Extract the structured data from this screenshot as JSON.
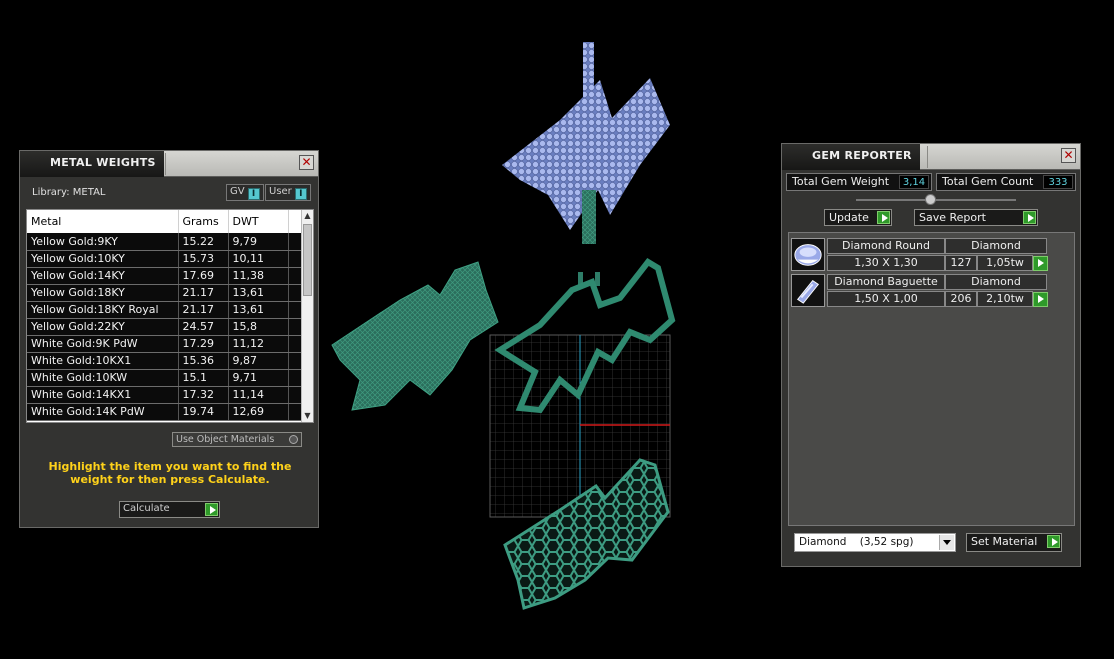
{
  "metal_weights": {
    "title": "METAL WEIGHTS",
    "library_label": "Library: METAL",
    "gv_label": "GV",
    "user_label": "User",
    "columns": [
      "Metal",
      "Grams",
      "DWT"
    ],
    "rows": [
      {
        "metal": "Yellow Gold:9KY",
        "grams": "15.22",
        "dwt": "9,79"
      },
      {
        "metal": "Yellow Gold:10KY",
        "grams": "15.73",
        "dwt": "10,11"
      },
      {
        "metal": "Yellow Gold:14KY",
        "grams": "17.69",
        "dwt": "11,38"
      },
      {
        "metal": "Yellow Gold:18KY",
        "grams": "21.17",
        "dwt": "13,61"
      },
      {
        "metal": "Yellow Gold:18KY Royal",
        "grams": "21.17",
        "dwt": "13,61"
      },
      {
        "metal": "Yellow Gold:22KY",
        "grams": "24.57",
        "dwt": "15,8"
      },
      {
        "metal": "White Gold:9K PdW",
        "grams": "17.29",
        "dwt": "11,12"
      },
      {
        "metal": "White Gold:10KX1",
        "grams": "15.36",
        "dwt": "9,87"
      },
      {
        "metal": "White Gold:10KW",
        "grams": "15.1",
        "dwt": "9,71"
      },
      {
        "metal": "White Gold:14KX1",
        "grams": "17.32",
        "dwt": "11,14"
      },
      {
        "metal": "White Gold:14K PdW",
        "grams": "19.74",
        "dwt": "12,69"
      }
    ],
    "use_object_materials": "Use Object Materials",
    "instruction": "Highlight the item you want to find the weight for then press Calculate.",
    "calculate_label": "Calculate"
  },
  "gem_reporter": {
    "title": "GEM REPORTER",
    "total_weight_label": "Total Gem Weight",
    "total_weight_value": "3,14",
    "total_count_label": "Total Gem Count",
    "total_count_value": "333",
    "update_label": "Update",
    "save_report_label": "Save Report",
    "gems": [
      {
        "name": "Diamond Round",
        "material": "Diamond",
        "size": "1,30 X 1,30",
        "count": "127",
        "weight": "1,05tw"
      },
      {
        "name": "Diamond Baguette",
        "material": "Diamond",
        "size": "1,50 X 1,00",
        "count": "206",
        "weight": "2,10tw"
      }
    ],
    "material_selected": "Diamond    (3,52 spg)",
    "set_material_label": "Set Material"
  },
  "colors": {
    "background": "#000000",
    "gem_blue": "#8fa4e0",
    "metal_green": "#2e7d68",
    "status_yellow": "#ffd21a",
    "value_cyan": "#5fd3df",
    "go_green": "#2f9a2a"
  }
}
